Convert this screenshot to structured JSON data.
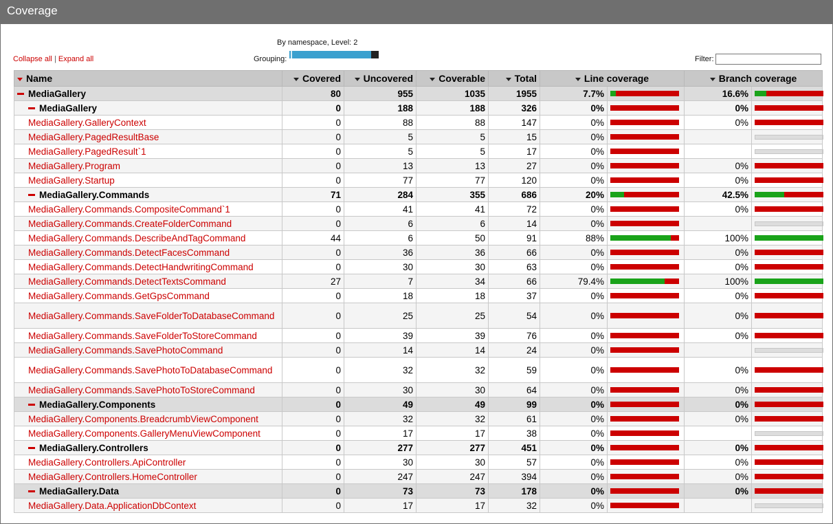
{
  "title": "Coverage",
  "links": {
    "collapse": "Collapse all",
    "separator": "|",
    "expand": "Expand all"
  },
  "grouping": {
    "caption": "By namespace, Level: 2",
    "label": "Grouping:"
  },
  "filter": {
    "label": "Filter:",
    "value": "",
    "placeholder": ""
  },
  "columns": {
    "name": "Name",
    "covered": "Covered",
    "uncovered": "Uncovered",
    "coverable": "Coverable",
    "total": "Total",
    "line": "Line coverage",
    "branch": "Branch coverage"
  },
  "colors": {
    "covered": "#1aa31a",
    "uncovered": "#cc0000",
    "header": "#c8c8c8",
    "namespace_row": "#dcdcdc"
  },
  "rows": [
    {
      "name": "MediaGallery",
      "kind": "root",
      "covered": "80",
      "uncovered": "955",
      "coverable": "1035",
      "total": "1955",
      "line": "7.7%",
      "line_frac": 0.077,
      "branch": "16.6%",
      "branch_frac": 0.166
    },
    {
      "name": "MediaGallery",
      "kind": "ns",
      "covered": "0",
      "uncovered": "188",
      "coverable": "188",
      "total": "326",
      "line": "0%",
      "line_frac": 0,
      "branch": "0%",
      "branch_frac": 0
    },
    {
      "name": "MediaGallery.GalleryContext",
      "kind": "cls",
      "covered": "0",
      "uncovered": "88",
      "coverable": "88",
      "total": "147",
      "line": "0%",
      "line_frac": 0,
      "branch": "0%",
      "branch_frac": 0
    },
    {
      "name": "MediaGallery.PagedResultBase",
      "kind": "cls",
      "covered": "0",
      "uncovered": "5",
      "coverable": "5",
      "total": "15",
      "line": "0%",
      "line_frac": 0,
      "branch": "",
      "branch_frac": null
    },
    {
      "name": "MediaGallery.PagedResult`1",
      "kind": "cls",
      "covered": "0",
      "uncovered": "5",
      "coverable": "5",
      "total": "17",
      "line": "0%",
      "line_frac": 0,
      "branch": "",
      "branch_frac": null
    },
    {
      "name": "MediaGallery.Program",
      "kind": "cls",
      "covered": "0",
      "uncovered": "13",
      "coverable": "13",
      "total": "27",
      "line": "0%",
      "line_frac": 0,
      "branch": "0%",
      "branch_frac": 0
    },
    {
      "name": "MediaGallery.Startup",
      "kind": "cls",
      "covered": "0",
      "uncovered": "77",
      "coverable": "77",
      "total": "120",
      "line": "0%",
      "line_frac": 0,
      "branch": "0%",
      "branch_frac": 0
    },
    {
      "name": "MediaGallery.Commands",
      "kind": "ns",
      "covered": "71",
      "uncovered": "284",
      "coverable": "355",
      "total": "686",
      "line": "20%",
      "line_frac": 0.2,
      "branch": "42.5%",
      "branch_frac": 0.425
    },
    {
      "name": "MediaGallery.Commands.CompositeCommand`1",
      "kind": "cls",
      "covered": "0",
      "uncovered": "41",
      "coverable": "41",
      "total": "72",
      "line": "0%",
      "line_frac": 0,
      "branch": "0%",
      "branch_frac": 0
    },
    {
      "name": "MediaGallery.Commands.CreateFolderCommand",
      "kind": "cls",
      "covered": "0",
      "uncovered": "6",
      "coverable": "6",
      "total": "14",
      "line": "0%",
      "line_frac": 0,
      "branch": "",
      "branch_frac": null
    },
    {
      "name": "MediaGallery.Commands.DescribeAndTagCommand",
      "kind": "cls",
      "covered": "44",
      "uncovered": "6",
      "coverable": "50",
      "total": "91",
      "line": "88%",
      "line_frac": 0.88,
      "branch": "100%",
      "branch_frac": 1
    },
    {
      "name": "MediaGallery.Commands.DetectFacesCommand",
      "kind": "cls",
      "covered": "0",
      "uncovered": "36",
      "coverable": "36",
      "total": "66",
      "line": "0%",
      "line_frac": 0,
      "branch": "0%",
      "branch_frac": 0
    },
    {
      "name": "MediaGallery.Commands.DetectHandwritingCommand",
      "kind": "cls",
      "covered": "0",
      "uncovered": "30",
      "coverable": "30",
      "total": "63",
      "line": "0%",
      "line_frac": 0,
      "branch": "0%",
      "branch_frac": 0
    },
    {
      "name": "MediaGallery.Commands.DetectTextsCommand",
      "kind": "cls",
      "covered": "27",
      "uncovered": "7",
      "coverable": "34",
      "total": "66",
      "line": "79.4%",
      "line_frac": 0.794,
      "branch": "100%",
      "branch_frac": 1
    },
    {
      "name": "MediaGallery.Commands.GetGpsCommand",
      "kind": "cls",
      "covered": "0",
      "uncovered": "18",
      "coverable": "18",
      "total": "37",
      "line": "0%",
      "line_frac": 0,
      "branch": "0%",
      "branch_frac": 0
    },
    {
      "name": "MediaGallery.Commands.SaveFolderToDatabaseCommand",
      "kind": "cls",
      "tall": true,
      "covered": "0",
      "uncovered": "25",
      "coverable": "25",
      "total": "54",
      "line": "0%",
      "line_frac": 0,
      "branch": "0%",
      "branch_frac": 0
    },
    {
      "name": "MediaGallery.Commands.SaveFolderToStoreCommand",
      "kind": "cls",
      "covered": "0",
      "uncovered": "39",
      "coverable": "39",
      "total": "76",
      "line": "0%",
      "line_frac": 0,
      "branch": "0%",
      "branch_frac": 0
    },
    {
      "name": "MediaGallery.Commands.SavePhotoCommand",
      "kind": "cls",
      "covered": "0",
      "uncovered": "14",
      "coverable": "14",
      "total": "24",
      "line": "0%",
      "line_frac": 0,
      "branch": "",
      "branch_frac": null
    },
    {
      "name": "MediaGallery.Commands.SavePhotoToDatabaseCommand",
      "kind": "cls",
      "tall": true,
      "covered": "0",
      "uncovered": "32",
      "coverable": "32",
      "total": "59",
      "line": "0%",
      "line_frac": 0,
      "branch": "0%",
      "branch_frac": 0
    },
    {
      "name": "MediaGallery.Commands.SavePhotoToStoreCommand",
      "kind": "cls",
      "covered": "0",
      "uncovered": "30",
      "coverable": "30",
      "total": "64",
      "line": "0%",
      "line_frac": 0,
      "branch": "0%",
      "branch_frac": 0
    },
    {
      "name": "MediaGallery.Components",
      "kind": "ns",
      "covered": "0",
      "uncovered": "49",
      "coverable": "49",
      "total": "99",
      "line": "0%",
      "line_frac": 0,
      "branch": "0%",
      "branch_frac": 0
    },
    {
      "name": "MediaGallery.Components.BreadcrumbViewComponent",
      "kind": "cls",
      "covered": "0",
      "uncovered": "32",
      "coverable": "32",
      "total": "61",
      "line": "0%",
      "line_frac": 0,
      "branch": "0%",
      "branch_frac": 0
    },
    {
      "name": "MediaGallery.Components.GalleryMenuViewComponent",
      "kind": "cls",
      "covered": "0",
      "uncovered": "17",
      "coverable": "17",
      "total": "38",
      "line": "0%",
      "line_frac": 0,
      "branch": "",
      "branch_frac": null
    },
    {
      "name": "MediaGallery.Controllers",
      "kind": "ns",
      "covered": "0",
      "uncovered": "277",
      "coverable": "277",
      "total": "451",
      "line": "0%",
      "line_frac": 0,
      "branch": "0%",
      "branch_frac": 0
    },
    {
      "name": "MediaGallery.Controllers.ApiController",
      "kind": "cls",
      "covered": "0",
      "uncovered": "30",
      "coverable": "30",
      "total": "57",
      "line": "0%",
      "line_frac": 0,
      "branch": "0%",
      "branch_frac": 0
    },
    {
      "name": "MediaGallery.Controllers.HomeController",
      "kind": "cls",
      "covered": "0",
      "uncovered": "247",
      "coverable": "247",
      "total": "394",
      "line": "0%",
      "line_frac": 0,
      "branch": "0%",
      "branch_frac": 0
    },
    {
      "name": "MediaGallery.Data",
      "kind": "ns",
      "covered": "0",
      "uncovered": "73",
      "coverable": "73",
      "total": "178",
      "line": "0%",
      "line_frac": 0,
      "branch": "0%",
      "branch_frac": 0
    },
    {
      "name": "MediaGallery.Data.ApplicationDbContext",
      "kind": "cls",
      "covered": "0",
      "uncovered": "17",
      "coverable": "17",
      "total": "32",
      "line": "0%",
      "line_frac": 0,
      "branch": "",
      "branch_frac": null
    }
  ]
}
